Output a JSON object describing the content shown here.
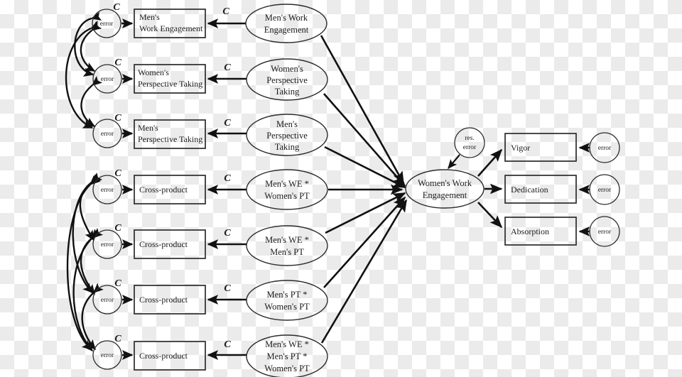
{
  "figure": {
    "type": "structural-equation-model-path-diagram",
    "title": "Moderated mediation SEM: Men's work engagement and perspective taking predicting Women's work engagement"
  },
  "colors": {
    "stroke": "#111111",
    "shape_stroke": "#2b2b2b",
    "text": "#1a1a1a",
    "background_light": "#ffffff",
    "background_check": "#ebebeb"
  },
  "labels": {
    "constraint": "C",
    "error": "error",
    "residual_error_line1": "res.",
    "residual_error_line2": "error"
  },
  "predictor_rows": [
    {
      "index": 1,
      "error_label": "error",
      "constraint_error": "C",
      "constraint_loading": "C",
      "indicator_lines": [
        "Men's",
        "Work Engagement"
      ],
      "latent_lines": [
        "Men's Work",
        "Engagement"
      ]
    },
    {
      "index": 2,
      "error_label": "error",
      "constraint_error": "C",
      "constraint_loading": "C",
      "indicator_lines": [
        "Women's",
        "Perspective Taking"
      ],
      "latent_lines": [
        "Women's",
        "Perspective",
        "Taking"
      ]
    },
    {
      "index": 3,
      "error_label": "error",
      "constraint_error": "C",
      "constraint_loading": "C",
      "indicator_lines": [
        "Men's",
        "Perspective Taking"
      ],
      "latent_lines": [
        "Men's",
        "Perspective",
        "Taking"
      ]
    },
    {
      "index": 4,
      "error_label": "error",
      "constraint_error": "C",
      "constraint_loading": "C",
      "indicator_lines": [
        "Cross-product"
      ],
      "latent_lines": [
        "Men's WE *",
        "Women's PT"
      ]
    },
    {
      "index": 5,
      "error_label": "error",
      "constraint_error": "C",
      "constraint_loading": "C",
      "indicator_lines": [
        "Cross-product"
      ],
      "latent_lines": [
        "Men's WE *",
        "Men's PT"
      ]
    },
    {
      "index": 6,
      "error_label": "error",
      "constraint_error": "C",
      "constraint_loading": "C",
      "indicator_lines": [
        "Cross-product"
      ],
      "latent_lines": [
        "Men's PT *",
        "Women's PT"
      ]
    },
    {
      "index": 7,
      "error_label": "error",
      "constraint_error": "C",
      "constraint_loading": "C",
      "indicator_lines": [
        "Cross-product"
      ],
      "latent_lines": [
        "Men's WE *",
        "Men's PT *",
        "Women's PT"
      ]
    }
  ],
  "outcome": {
    "latent_lines": [
      "Women's Work",
      "Engagement"
    ],
    "residual_lines": [
      "res.",
      "error"
    ],
    "indicators": [
      {
        "label": "Vigor",
        "error_label": "error"
      },
      {
        "label": "Dedication",
        "error_label": "error"
      },
      {
        "label": "Absorption",
        "error_label": "error"
      }
    ]
  }
}
